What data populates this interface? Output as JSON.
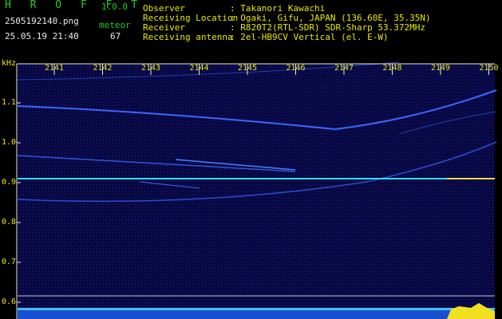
{
  "app": {
    "name": "H R O F F T",
    "version": "1.0.0"
  },
  "file": {
    "name": "2505192140.png",
    "datetime": "25.05.19 21:40"
  },
  "mode": {
    "label": "meteor",
    "count": "67"
  },
  "info": [
    {
      "key": "Observer",
      "value": ": Takanori Kawachi"
    },
    {
      "key": "Receiving Location",
      "value": ": Ogaki, Gifu, JAPAN (136.60E, 35.35N)"
    },
    {
      "key": "Receiver",
      "value": ": R820T2(RTL-SDR) SDR-Sharp 53.372MHz"
    },
    {
      "key": "Receiving antenna",
      "value": ": 2el-HB9CV Vertical (el. E-W)"
    }
  ],
  "axis": {
    "unit": "kHz",
    "x_ticks": [
      "2141",
      "2142",
      "2143",
      "2144",
      "2145",
      "2146",
      "2147",
      "2148",
      "2149",
      "2150"
    ],
    "y_ticks": [
      "1.1",
      "1.0",
      "0.9",
      "0.8",
      "0.7",
      "0.6"
    ]
  },
  "colors": {
    "header_green": "#1fd01f",
    "header_yellow": "#e8e800",
    "background": "#000000",
    "spectrum": "#0a0a6e",
    "carrier": "#30e0ff"
  }
}
